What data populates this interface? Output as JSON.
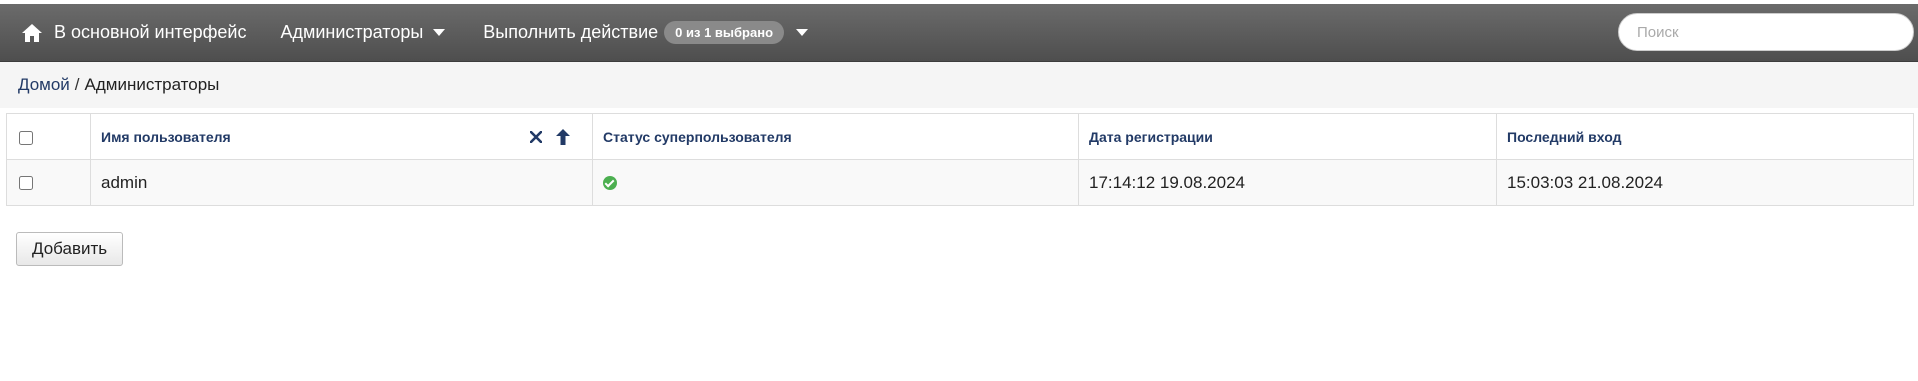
{
  "navbar": {
    "home_label": "В основной интерфейс",
    "admins_menu_label": "Администраторы",
    "action_label": "Выполнить действие",
    "selection_badge": "0 из 1 выбрано",
    "search_placeholder": "Поиск",
    "icons": {
      "home": "home-icon",
      "menu_caret": "chevron-down-icon",
      "action_caret": "chevron-down-icon"
    }
  },
  "breadcrumb": {
    "home_link": "Домой",
    "separator": "/",
    "current": "Администраторы"
  },
  "table": {
    "columns": [
      {
        "key": "username",
        "label": "Имя пользователя"
      },
      {
        "key": "superuser",
        "label": "Статус суперпользователя"
      },
      {
        "key": "registered",
        "label": "Дата регистрации"
      },
      {
        "key": "last_login",
        "label": "Последний вход"
      }
    ],
    "sort_icons": [
      "close-icon",
      "arrow-up-icon"
    ],
    "rows": [
      {
        "username": "admin",
        "superuser_icon": "check-circle-icon",
        "registered": "17:14:12 19.08.2024",
        "last_login": "15:03:03 21.08.2024"
      }
    ]
  },
  "add_button_label": "Добавить",
  "colors": {
    "navbar": "#555555",
    "header_text": "#223a66",
    "ok_green": "#4caf50"
  }
}
